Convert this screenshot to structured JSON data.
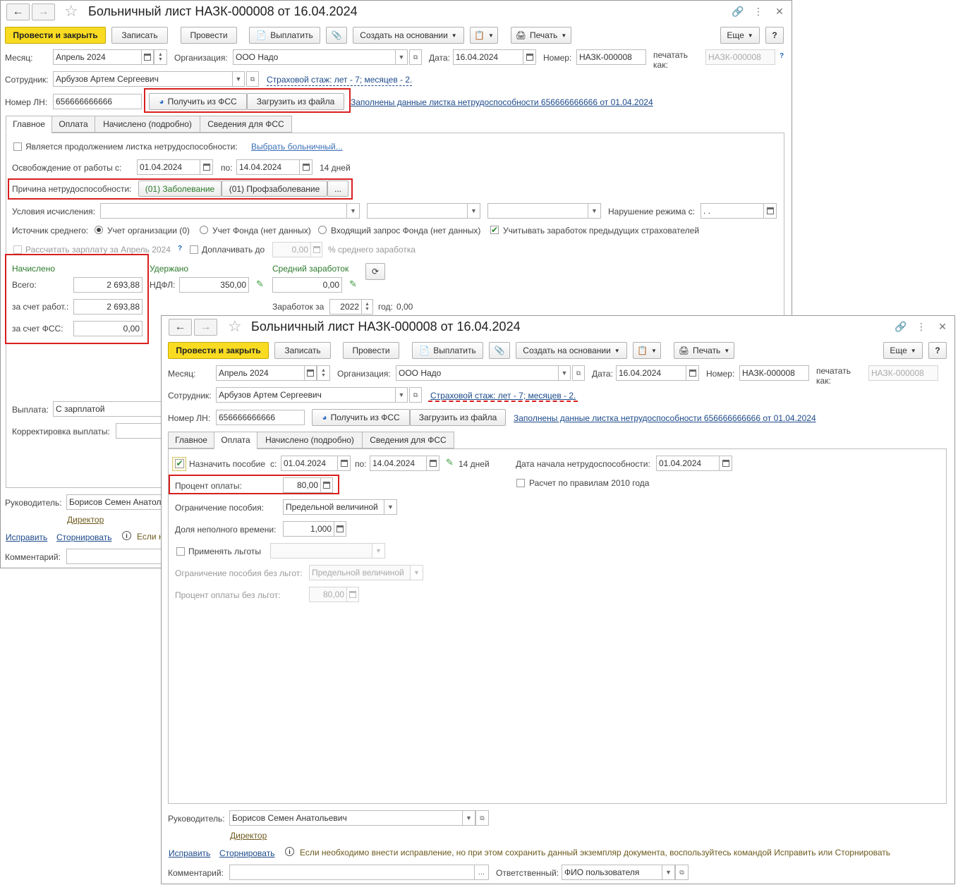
{
  "doc_title": "Больничный лист НАЗК-000008 от 16.04.2024",
  "toolbar": {
    "post_close": "Провести и закрыть",
    "save": "Записать",
    "post": "Провести",
    "pay": "Выплатить",
    "create_based": "Создать на основании",
    "print": "Печать",
    "more": "Еще",
    "help": "?"
  },
  "header": {
    "month_label": "Месяц:",
    "month_value": "Апрель 2024",
    "org_label": "Организация:",
    "org_value": "ООО Надо",
    "date_label": "Дата:",
    "date_value": "16.04.2024",
    "number_label": "Номер:",
    "number_value": "НАЗК-000008",
    "print_as_label_1": "печатать",
    "print_as_label_2": "как:",
    "print_as_value": "НАЗК-000008",
    "employee_label": "Сотрудник:",
    "employee_value": "Арбузов Артем Сергеевич",
    "experience_link": "Страховой стаж: лет - 7; месяцев - 2.",
    "ln_label": "Номер ЛН:",
    "ln_value": "656666666666",
    "get_fss": "Получить из ФСС",
    "load_file": "Загрузить из файла",
    "filled_link": "Заполнены данные листка нетрудоспособности 656666666666 от 01.04.2024"
  },
  "tabs": [
    "Главное",
    "Оплата",
    "Начислено (подробно)",
    "Сведения для ФСС"
  ],
  "main_tab": {
    "continuation_label": "Является продолжением листка нетрудоспособности:",
    "choose_link": "Выбрать больничный...",
    "release_label": "Освобождение от работы с:",
    "release_from": "01.04.2024",
    "to_label": "по:",
    "release_to": "14.04.2024",
    "days": "14 дней",
    "reason_label": "Причина нетрудоспособности:",
    "reason_1": "(01) Заболевание",
    "reason_2": "(01) Профзаболевание",
    "reason_more": "...",
    "conditions_label": "Условия исчисления:",
    "violation_label": "Нарушение режима с:",
    "violation_value": ". .",
    "avg_source_label": "Источник среднего:",
    "src_1": "Учет организации (0)",
    "src_2": "Учет Фонда (нет данных)",
    "src_3": "Входящий запрос Фонда (нет данных)",
    "consider_prev": "Учитывать заработок предыдущих страхователей",
    "calc_salary": "Рассчитать зарплату за Апрель 2024",
    "topup_label": "Доплачивать до",
    "topup_value": "0,00",
    "topup_suffix": "% среднего заработка",
    "accrued_title": "Начислено",
    "total_label": "Всего:",
    "total_value": "2 693,88",
    "employer_label": "за счет работ.:",
    "employer_value": "2 693,88",
    "fss_label": "за счет ФСС:",
    "fss_value": "0,00",
    "withheld_title": "Удержано",
    "ndfl_label": "НДФЛ:",
    "ndfl_value": "350,00",
    "avg_title": "Средний заработок",
    "avg_value": "0,00",
    "earnings_for_label": "Заработок за",
    "earnings_year": "2022",
    "year_label": "год:",
    "year_value": "0,00",
    "payout_label": "Выплата:",
    "payout_value": "С зарплатой",
    "payout_corr_label": "Корректировка выплаты:"
  },
  "pay_tab": {
    "assign_label": "Назначить пособие",
    "from_label": "с:",
    "from_value": "01.04.2024",
    "to_label": "по:",
    "to_value": "14.04.2024",
    "days": "14 дней",
    "start_label": "Дата начала нетрудоспособности:",
    "start_value": "01.04.2024",
    "percent_label": "Процент оплаты:",
    "percent_value": "80,00",
    "rules2010_label": "Расчет по правилам 2010 года",
    "limit_label": "Ограничение пособия:",
    "limit_value": "Предельной величиной",
    "parttime_label": "Доля неполного времени:",
    "parttime_value": "1,000",
    "benefits_label": "Применять льготы",
    "limit_nobenefit_label": "Ограничение пособия без льгот:",
    "limit_nobenefit_value": "Предельной величиной",
    "percent_nobenefit_label": "Процент оплаты без льгот:",
    "percent_nobenefit_value": "80,00"
  },
  "footer": {
    "head_label": "Руководитель:",
    "head_value": "Борисов Семен Анатольевич",
    "head_value_short": "Борисов Семен Анатол",
    "position_link": "Директор",
    "fix_link": "Исправить",
    "storno_link": "Сторнировать",
    "hint": "Если необходимо внести исправление, но при этом сохранить данный экземпляр документа, воспользуйтесь командой Исправить или Сторнировать",
    "hint_short": "Если н",
    "comment_label": "Комментарий:",
    "responsible_label": "Ответственный:",
    "responsible_value": "ФИО пользователя",
    "more_dots": "..."
  }
}
